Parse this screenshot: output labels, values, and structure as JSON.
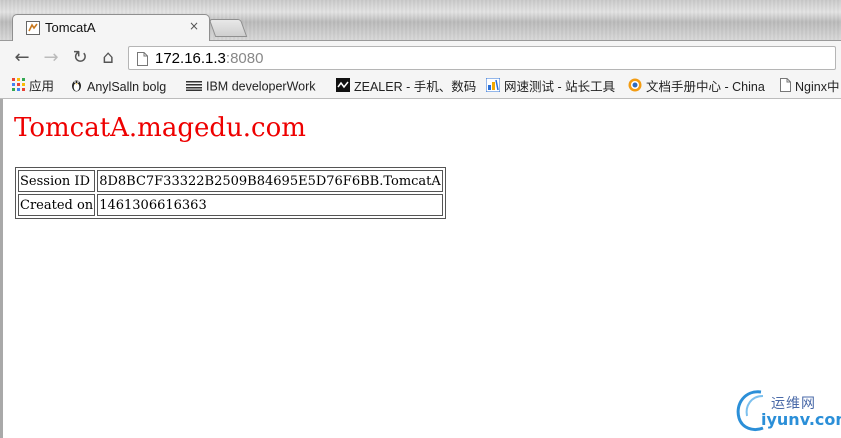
{
  "browser": {
    "tab": {
      "title": "TomcatA",
      "close_glyph": "×",
      "favicon": "tomcat-icon"
    },
    "nav": {
      "back_glyph": "←",
      "forward_glyph": "→",
      "reload_glyph": "↻",
      "home_glyph": "⌂"
    },
    "address": {
      "host": "172.16.1.3",
      "port": ":8080"
    },
    "bookmarks": [
      {
        "label": "应用",
        "icon": "apps-grid-icon"
      },
      {
        "label": "AnylSalln bolg",
        "icon": "penguin-icon"
      },
      {
        "label": "IBM developerWork",
        "icon": "ibm-icon"
      },
      {
        "label": "ZEALER - 手机、数码",
        "icon": "zealer-icon"
      },
      {
        "label": "网速测试 - 站长工具",
        "icon": "speedtest-icon"
      },
      {
        "label": "文档手册中心 - China",
        "icon": "docs-icon"
      },
      {
        "label": "Nginx中",
        "icon": "page-icon"
      }
    ]
  },
  "page": {
    "heading": "TomcatA.magedu.com",
    "heading_color": "#ee0000",
    "session_table": [
      {
        "label": "Session ID",
        "value": "8D8BC7F33322B2509B84695E5D76F6BB.TomcatA"
      },
      {
        "label": "Created on",
        "value": "1461306616363"
      }
    ]
  },
  "watermark": {
    "line1": "运维网",
    "line2": "iyunv.com"
  }
}
